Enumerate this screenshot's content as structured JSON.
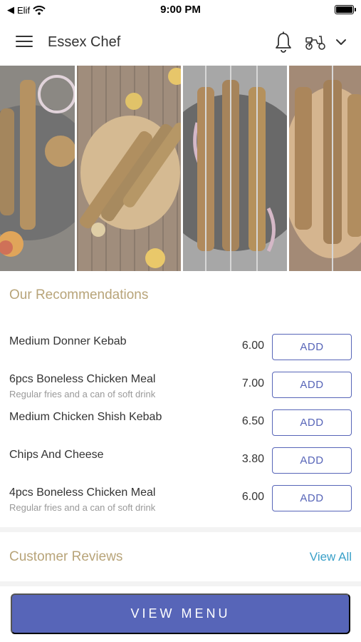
{
  "status_bar": {
    "back_app": "Elif",
    "time": "9:00 PM"
  },
  "header": {
    "title": "Essex Chef",
    "icons": [
      "menu-icon",
      "bell-icon",
      "scooter-icon",
      "chevron-down-icon"
    ]
  },
  "recommendations": {
    "title": "Our Recommendations",
    "items": [
      {
        "name": "Medium Donner Kebab",
        "description": "",
        "price": "6.00",
        "button": "ADD"
      },
      {
        "name": "6pcs Boneless Chicken Meal",
        "description": "Regular fries and a can of soft drink",
        "price": "7.00",
        "button": "ADD"
      },
      {
        "name": "Medium Chicken Shish Kebab",
        "description": "",
        "price": "6.50",
        "button": "ADD"
      },
      {
        "name": "Chips And Cheese",
        "description": "",
        "price": "3.80",
        "button": "ADD"
      },
      {
        "name": "4pcs Boneless Chicken Meal",
        "description": "Regular fries and a can of soft drink",
        "price": "6.00",
        "button": "ADD"
      }
    ]
  },
  "reviews": {
    "title": "Customer Reviews",
    "view_all": "View All"
  },
  "footer": {
    "view_menu": "VIEW MENU"
  },
  "colors": {
    "accent": "#5765b8",
    "section_title": "#b8a479",
    "link": "#3aa0c8"
  }
}
